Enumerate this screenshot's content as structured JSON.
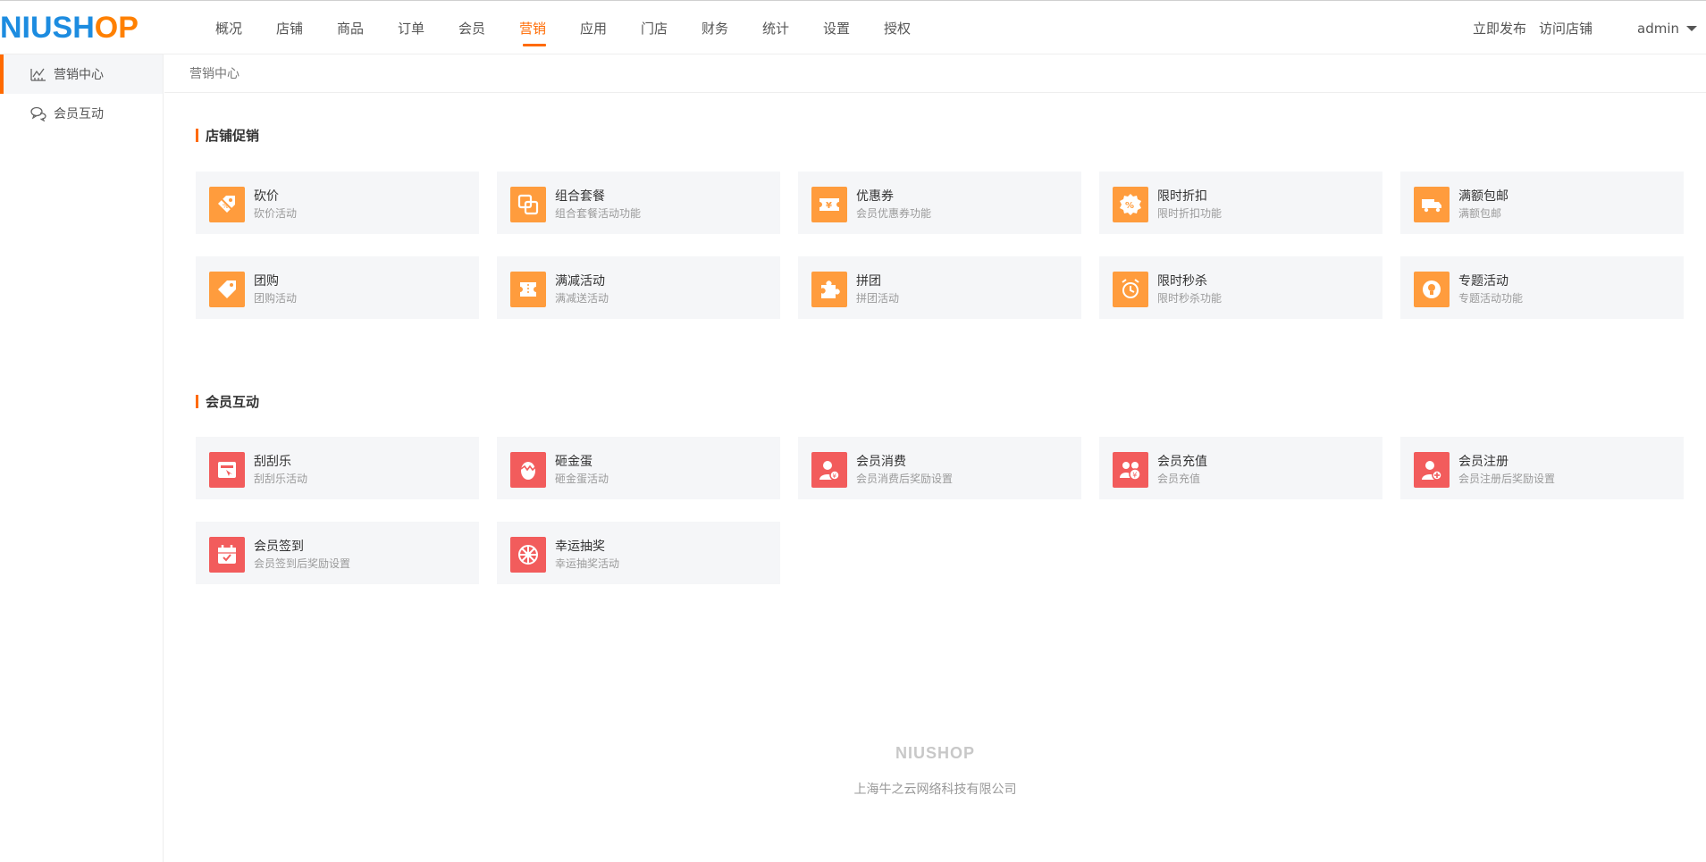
{
  "logo": {
    "part1": "NIUSH",
    "part2": "OP"
  },
  "nav": {
    "items": [
      {
        "label": "概况"
      },
      {
        "label": "店铺"
      },
      {
        "label": "商品"
      },
      {
        "label": "订单"
      },
      {
        "label": "会员"
      },
      {
        "label": "营销"
      },
      {
        "label": "应用"
      },
      {
        "label": "门店"
      },
      {
        "label": "财务"
      },
      {
        "label": "统计"
      },
      {
        "label": "设置"
      },
      {
        "label": "授权"
      }
    ],
    "active_index": 5
  },
  "header": {
    "publish_label": "立即发布",
    "visit_label": "访问店铺",
    "user_label": "admin"
  },
  "sidebar": {
    "items": [
      {
        "label": "营销中心",
        "icon": "chart-icon"
      },
      {
        "label": "会员互动",
        "icon": "chat-icon"
      }
    ],
    "active_index": 0
  },
  "breadcrumb": {
    "current": "营销中心"
  },
  "sections": [
    {
      "title": "店铺促销",
      "cards": [
        {
          "title": "砍价",
          "desc": "砍价活动",
          "icon": "tag-cut-icon",
          "color": "#ff9c3d"
        },
        {
          "title": "组合套餐",
          "desc": "组合套餐活动功能",
          "icon": "combo-icon",
          "color": "#ff9c3d"
        },
        {
          "title": "优惠券",
          "desc": "会员优惠券功能",
          "icon": "coupon-icon",
          "color": "#ff9c3d"
        },
        {
          "title": "限时折扣",
          "desc": "限时折扣功能",
          "icon": "discount-icon",
          "color": "#ff9c3d"
        },
        {
          "title": "满额包邮",
          "desc": "满额包邮",
          "icon": "truck-icon",
          "color": "#ff9c3d"
        },
        {
          "title": "团购",
          "desc": "团购活动",
          "icon": "price-tag-icon",
          "color": "#ff9c3d"
        },
        {
          "title": "满减活动",
          "desc": "满减送活动",
          "icon": "ticket-icon",
          "color": "#ff9c3d"
        },
        {
          "title": "拼团",
          "desc": "拼团活动",
          "icon": "puzzle-icon",
          "color": "#ff9c3d"
        },
        {
          "title": "限时秒杀",
          "desc": "限时秒杀功能",
          "icon": "alarm-clock-icon",
          "color": "#ff9c3d"
        },
        {
          "title": "专题活动",
          "desc": "专题活动功能",
          "icon": "bulb-icon",
          "color": "#ff9c3d"
        }
      ]
    },
    {
      "title": "会员互动",
      "cards": [
        {
          "title": "刮刮乐",
          "desc": "刮刮乐活动",
          "icon": "scratch-card-icon",
          "color": "#f25c5c"
        },
        {
          "title": "砸金蛋",
          "desc": "砸金蛋活动",
          "icon": "egg-icon",
          "color": "#f25c5c"
        },
        {
          "title": "会员消费",
          "desc": "会员消费后奖励设置",
          "icon": "member-consume-icon",
          "color": "#f25c5c"
        },
        {
          "title": "会员充值",
          "desc": "会员充值",
          "icon": "member-recharge-icon",
          "color": "#f25c5c"
        },
        {
          "title": "会员注册",
          "desc": "会员注册后奖励设置",
          "icon": "member-register-icon",
          "color": "#f25c5c"
        },
        {
          "title": "会员签到",
          "desc": "会员签到后奖励设置",
          "icon": "calendar-check-icon",
          "color": "#f25c5c"
        },
        {
          "title": "幸运抽奖",
          "desc": "幸运抽奖活动",
          "icon": "wheel-icon",
          "color": "#f25c5c"
        }
      ]
    }
  ],
  "footer": {
    "logo": "NIUSHOP",
    "company": "上海牛之云网络科技有限公司"
  }
}
